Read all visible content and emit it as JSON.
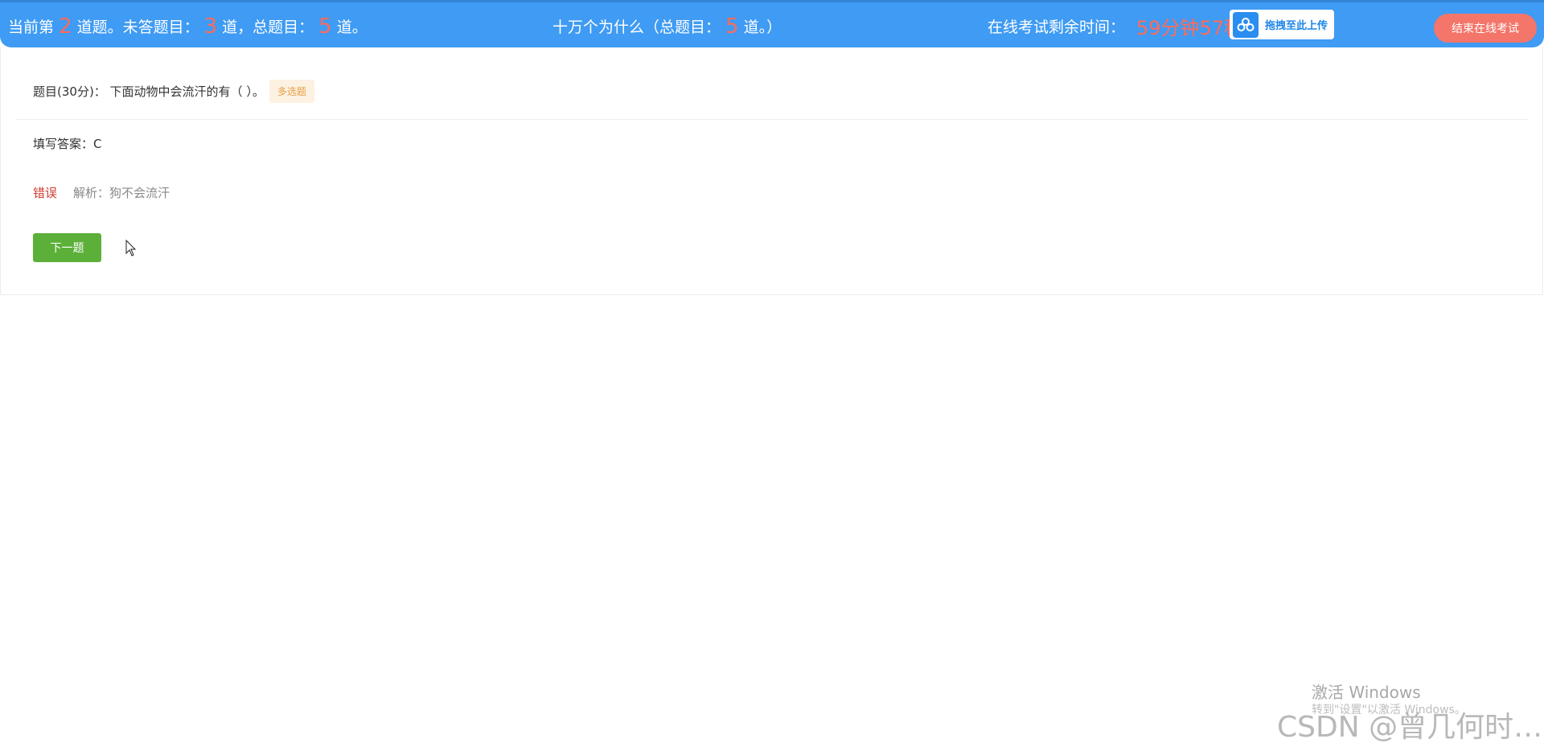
{
  "header": {
    "current_prefix": "当前第",
    "current_num": "2",
    "current_suffix": "道题。未答题目：",
    "unanswered_num": "3",
    "unanswered_suffix": "道，总题目：",
    "total_num": "5",
    "total_suffix": "道。",
    "exam_title": "十万个为什么（总题目：",
    "exam_total_num": "5",
    "exam_title_suffix": "道。）",
    "timer_label": "在线考试剩余时间：",
    "timer_value": "59分钟57秒",
    "upload_label": "拖拽至此上传",
    "end_exam_label": "结束在线考试"
  },
  "question": {
    "title": "题目(30分)：  下面动物中会流汗的有（ ）。",
    "type_tag": "多选题"
  },
  "answer": {
    "text": "填写答案：C"
  },
  "result": {
    "status": "错误",
    "analysis": "解析：狗不会流汗"
  },
  "actions": {
    "next_label": "下一题"
  },
  "watermarks": {
    "activate_title": "激活 Windows",
    "activate_sub": "转到\"设置\"以激活 Windows。",
    "csdn": "CSDN @曾几何时…"
  },
  "colors": {
    "header_bg": "#3f9bf3",
    "highlight": "#ff6b5a",
    "end_button": "#f4756a",
    "next_button": "#5cb039",
    "wrong": "#d03b2f",
    "tag_bg": "#fdf1e2",
    "tag_text": "#e6a045"
  }
}
